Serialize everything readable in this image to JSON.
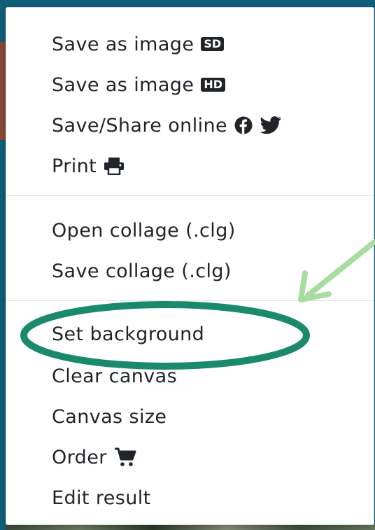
{
  "menu": {
    "items": [
      {
        "label": "Save as image",
        "badge": "SD"
      },
      {
        "label": "Save as image",
        "badge": "HD"
      },
      {
        "label": "Save/Share online",
        "icons": [
          "facebook-icon",
          "twitter-icon"
        ]
      },
      {
        "label": "Print",
        "icons": [
          "printer-icon"
        ]
      },
      {
        "label": "Open collage (.clg)"
      },
      {
        "label": "Save collage (.clg)"
      },
      {
        "label": "Set background"
      },
      {
        "label": "Clear canvas"
      },
      {
        "label": "Canvas size"
      },
      {
        "label": "Order",
        "icons": [
          "shopping-cart-icon"
        ]
      },
      {
        "label": "Edit result"
      }
    ]
  },
  "annotation": {
    "ellipse_color": "#1a8a6a",
    "arrow_color": "#a8dca0"
  }
}
